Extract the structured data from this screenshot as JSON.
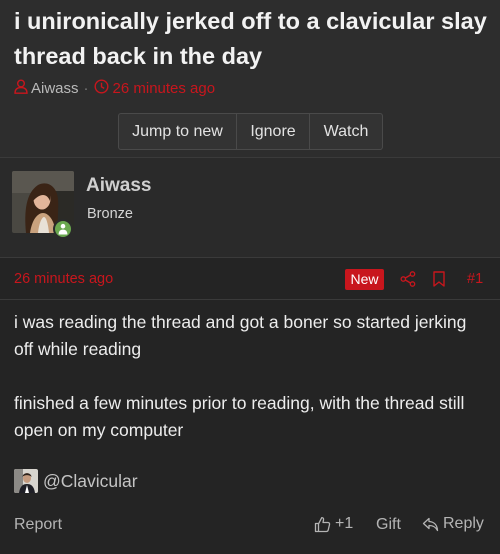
{
  "thread": {
    "title": "i unironically jerked off to a clavicular slay thread back in the day",
    "author": "Aiwass",
    "separator": "·",
    "time": "26 minutes ago",
    "actions": {
      "jump": "Jump to new",
      "ignore": "Ignore",
      "watch": "Watch"
    }
  },
  "post": {
    "username": "Aiwass",
    "user_title": "Bronze",
    "time": "26 minutes ago",
    "badge": "New",
    "number": "#1",
    "body": {
      "p1": "i was reading the thread and got a boner so started jerking off while reading",
      "p2": "finished a few minutes prior to reading, with the thread still open on my computer"
    },
    "mention": "@Clavicular",
    "footer": {
      "report": "Report",
      "like": "+1",
      "gift": "Gift",
      "reply": "Reply"
    }
  },
  "colors": {
    "accent": "#c8161d",
    "background": "#242424",
    "online": "#6aa84f"
  },
  "icons": [
    "user-icon",
    "clock-icon",
    "online-person-icon",
    "share-icon",
    "bookmark-icon",
    "thumbs-up-icon",
    "reply-icon"
  ]
}
